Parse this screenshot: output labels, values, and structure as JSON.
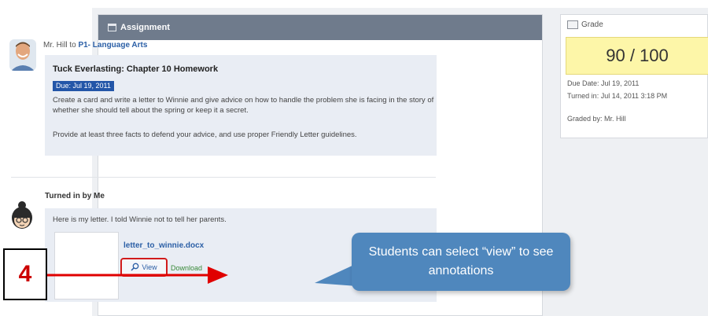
{
  "assignment": {
    "header_title": "Assignment",
    "from_prefix": "Mr. Hill to",
    "course": "P1- Language Arts",
    "title": "Tuck Everlasting: Chapter 10 Homework",
    "due_badge": "Due: Jul 19, 2011",
    "description": "Create a card and write a letter to Winnie and give advice on how to handle the problem she is facing in the story of whether she should tell about the spring or keep it a secret.",
    "advice": "Provide at least three facts to defend your advice, and use proper Friendly Letter guidelines."
  },
  "submission": {
    "label": "Turned in by Me",
    "comment": "Here is my letter. I told Winnie not to tell her parents.",
    "file_name": "letter_to_winnie.docx",
    "view_label": "View",
    "download_label": "Download"
  },
  "grade": {
    "title": "Grade",
    "score": "90 / 100",
    "due_date": "Due Date: Jul 19, 2011",
    "turned_in": "Turned in: Jul 14, 2011 3:18 PM",
    "graded_by": "Graded by: Mr. Hill"
  },
  "annotation": {
    "step_number": "4",
    "callout_text": "Students can select “view” to see annotations"
  },
  "colors": {
    "header": "#6f7b8c",
    "link": "#2b5fa6",
    "highlight": "#d11b1b",
    "callout": "#4f87bd",
    "score_bg": "#fdf6a8"
  }
}
